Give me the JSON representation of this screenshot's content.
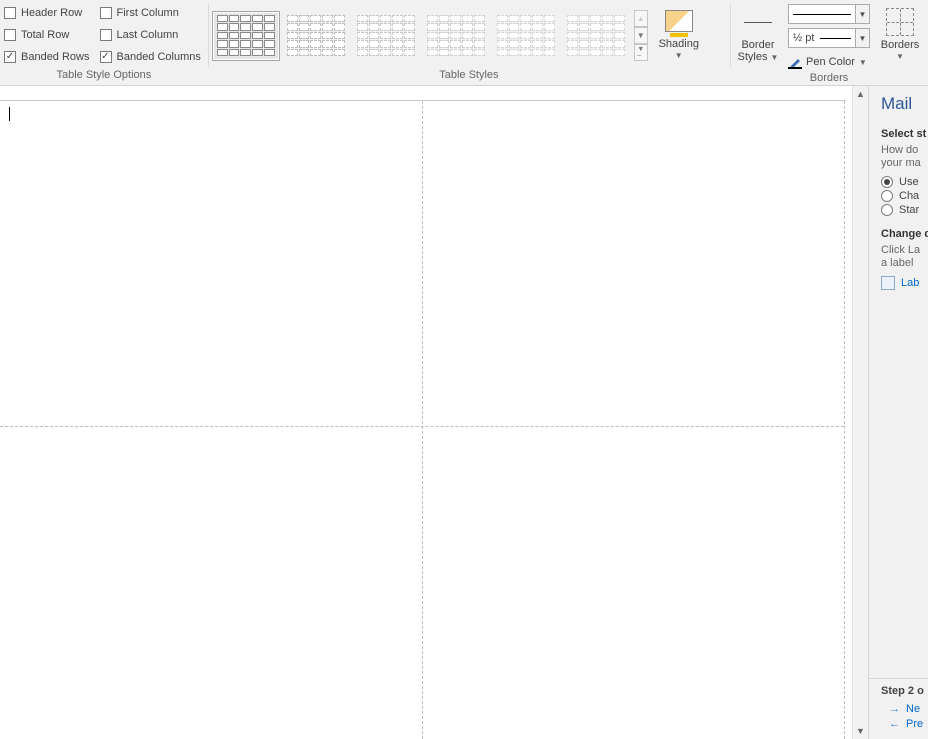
{
  "ribbon": {
    "tableStyleOptions": {
      "label": "Table Style Options",
      "headerRow": "Header Row",
      "totalRow": "Total Row",
      "bandedRows": "Banded Rows",
      "firstColumn": "First Column",
      "lastColumn": "Last Column",
      "bandedColumns": "Banded Columns"
    },
    "tableStyles": {
      "label": "Table Styles"
    },
    "shading": {
      "label": "Shading"
    },
    "borderStyles": {
      "label1": "Border",
      "label2": "Styles"
    },
    "penWeight": "½ pt",
    "penColor": "Pen Color",
    "bordersBtn": "Borders",
    "bordersGroup": {
      "label": "Borders"
    }
  },
  "mail": {
    "title": "Mail",
    "selectHead": "Select st",
    "help1": "How do",
    "help2": "your ma",
    "optUse": "Use",
    "optCha": "Cha",
    "optStar": "Star",
    "changeHead": "Change d",
    "changeHelp1": "Click La",
    "changeHelp2": "a label",
    "labelLink": "Lab",
    "stepHead": "Step 2 o",
    "next": "Ne",
    "prev": "Pre"
  }
}
